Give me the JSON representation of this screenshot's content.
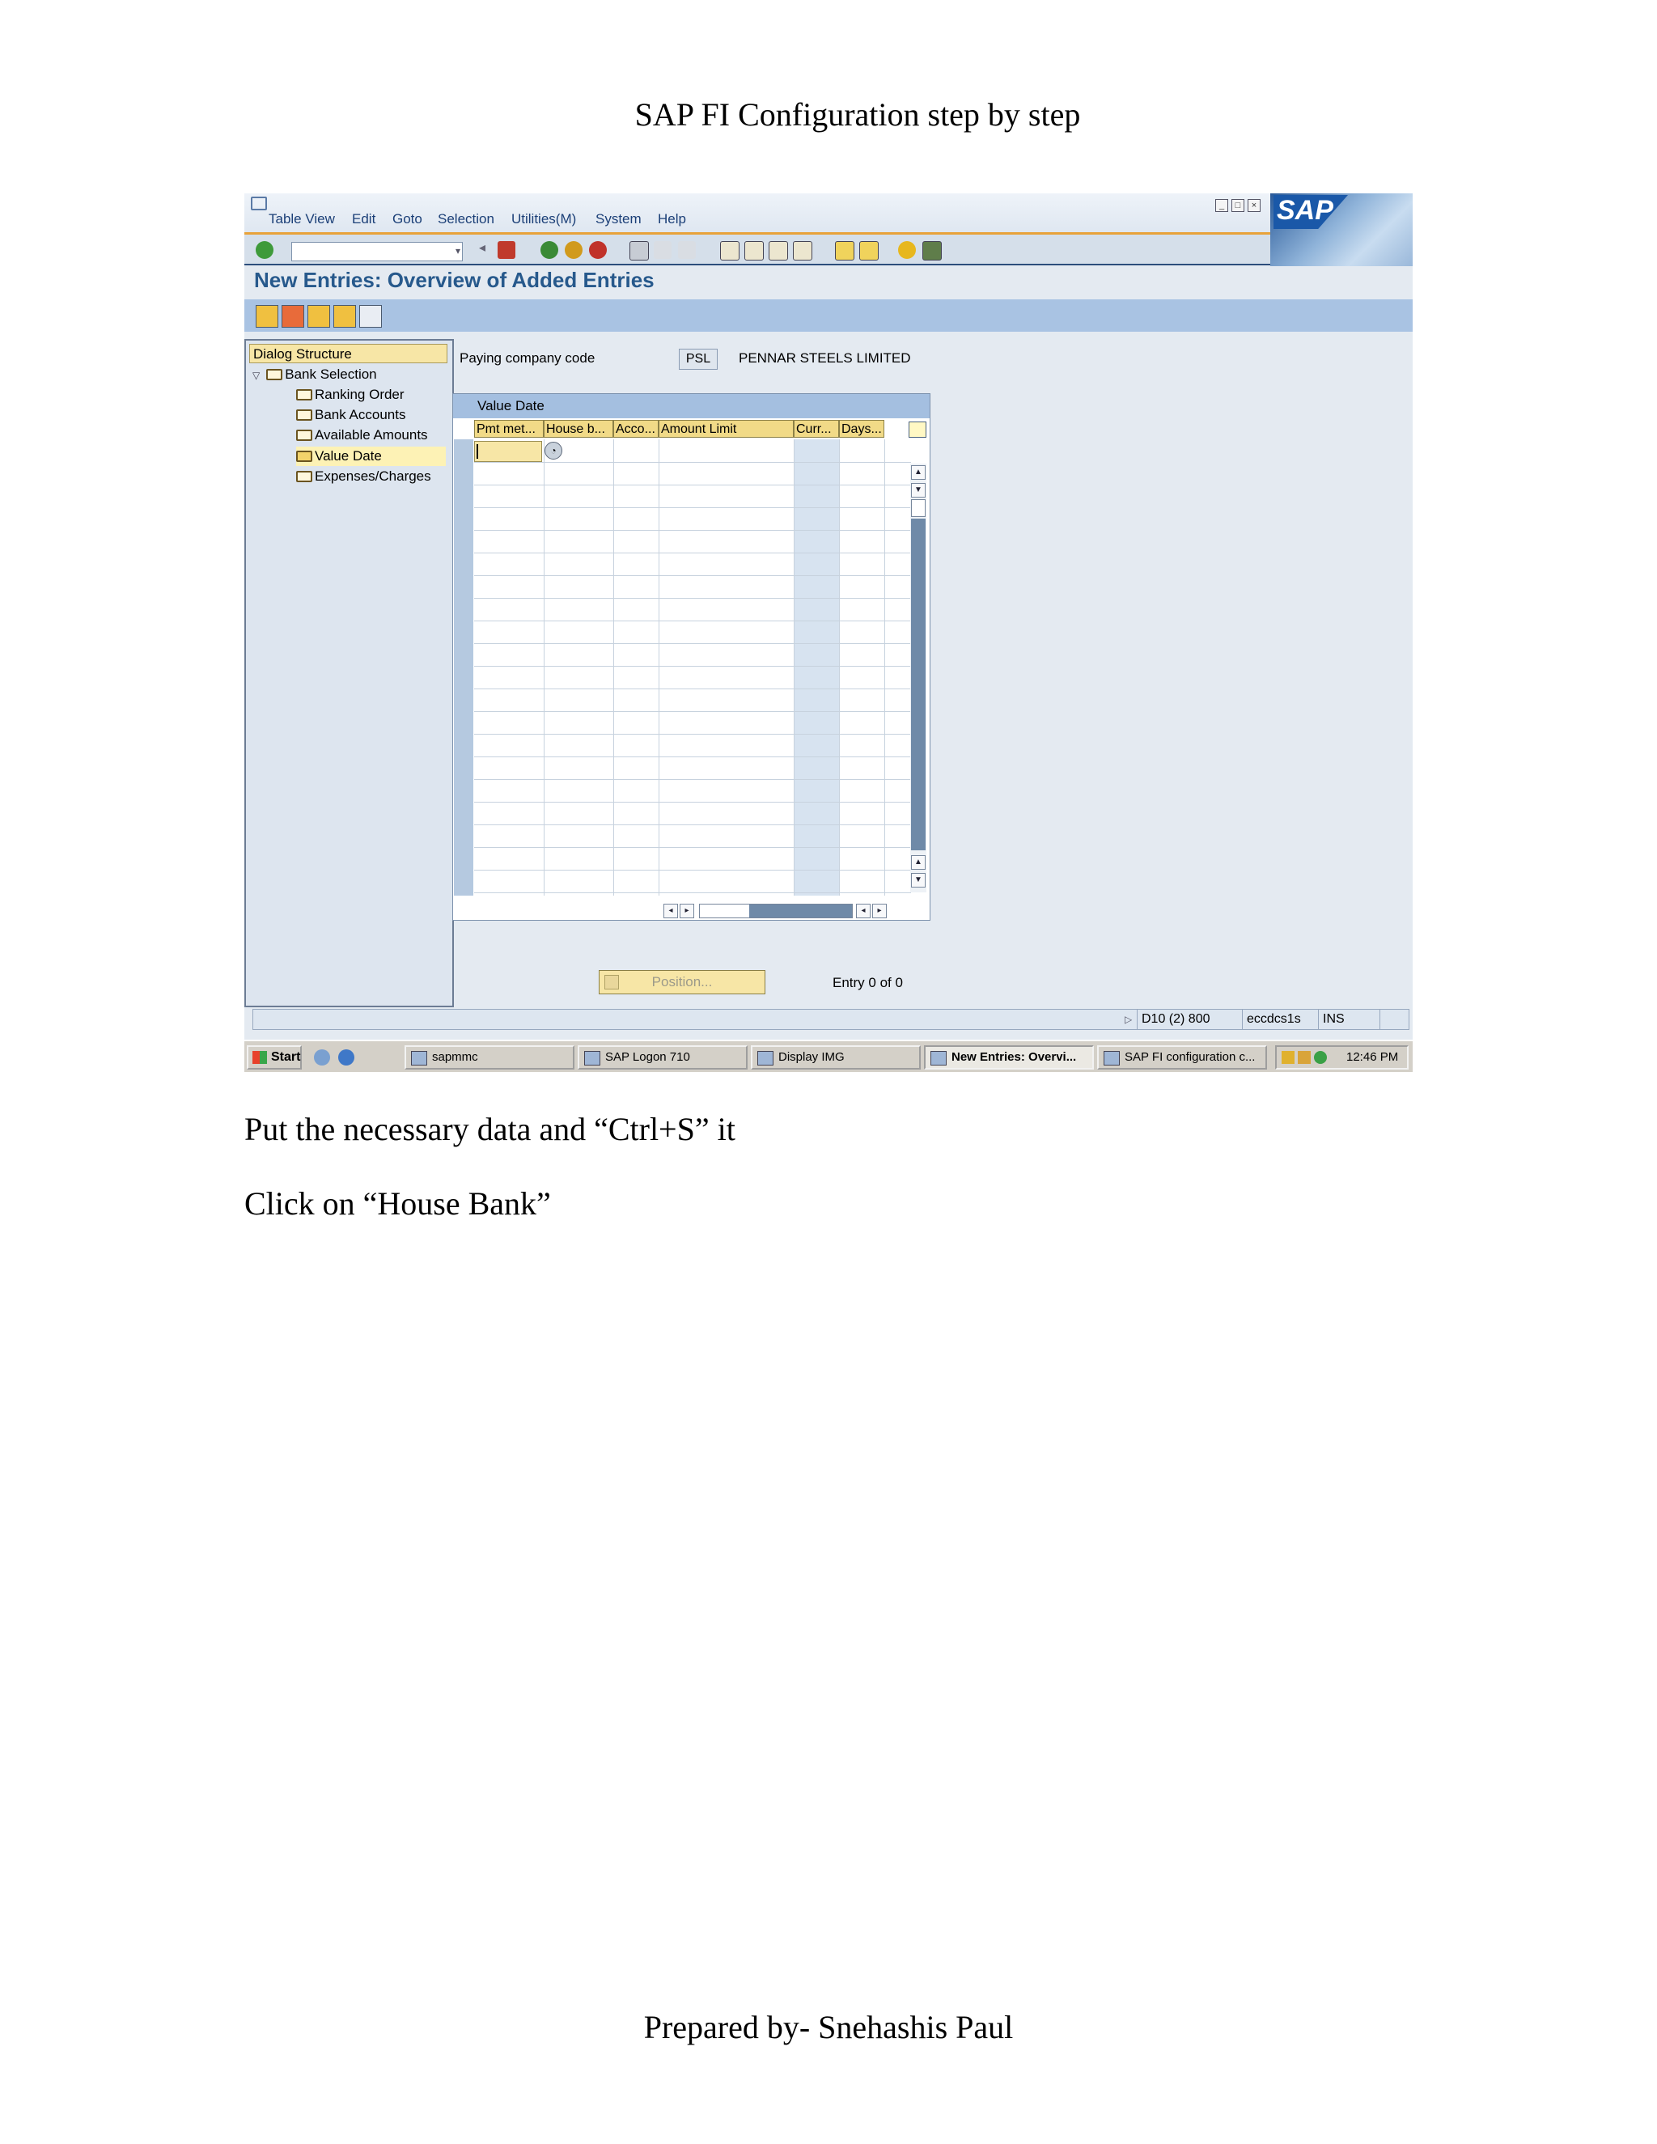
{
  "document": {
    "title": "SAP FI Configuration step by step",
    "instruction_1": "Put the necessary data and “Ctrl+S” it",
    "instruction_2": "Click on “House Bank”",
    "footer": "Prepared by- Snehashis Paul"
  },
  "sap": {
    "menu": [
      "Table View",
      "Edit",
      "Goto",
      "Selection",
      "Utilities(M)",
      "System",
      "Help"
    ],
    "logo_text": "SAP",
    "page_title": "New Entries: Overview of Added Entries",
    "dialog_structure": {
      "header": "Dialog Structure",
      "items": [
        "Bank Selection",
        "Ranking Order",
        "Bank Accounts",
        "Available Amounts",
        "Value Date",
        "Expenses/Charges"
      ],
      "selected": "Value Date"
    },
    "paying_company_code": {
      "label": "Paying company code",
      "value": "PSL",
      "name": "PENNAR STEELS LIMITED"
    },
    "table": {
      "title": "Value Date",
      "columns": [
        "Pmt met...",
        "House b...",
        "Acco...",
        "Amount Limit",
        "Curr...",
        "Days..."
      ],
      "rows": []
    },
    "position_button": "Position...",
    "entry_text": "Entry 0 of 0",
    "status_bar": {
      "system": "D10 (2) 800",
      "server": "eccdcs1s",
      "mode": "INS"
    },
    "taskbar": {
      "start": "Start",
      "tasks": [
        "sapmmc",
        "SAP Logon 710",
        "Display IMG",
        "New Entries: Overvi...",
        "SAP FI configuration c..."
      ],
      "active_task": "New Entries: Overvi...",
      "clock": "12:46 PM"
    }
  },
  "colors": {
    "title_blue": "#27598c",
    "header_yellow": "#f1da87",
    "menubar_accent": "#e8a23a"
  }
}
